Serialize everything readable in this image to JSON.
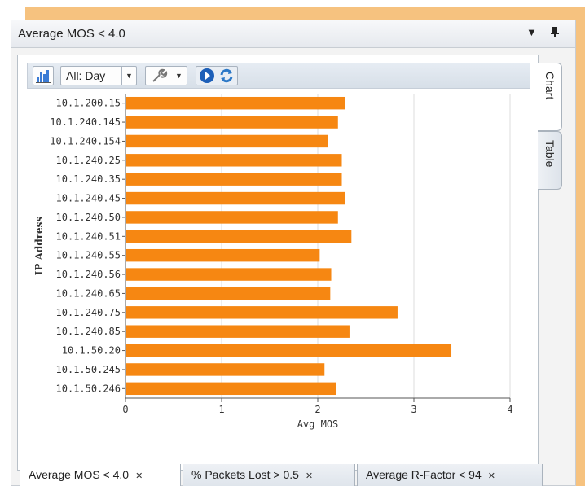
{
  "window": {
    "title": "Average MOS < 4.0"
  },
  "toolbar": {
    "range_label": "All: Day"
  },
  "side_tabs": [
    "Chart",
    "Table"
  ],
  "bottom_tabs": [
    {
      "label": "Average MOS < 4.0",
      "active": true
    },
    {
      "label": "% Packets Lost > 0.5",
      "active": false
    },
    {
      "label": "Average R-Factor < 94",
      "active": false
    }
  ],
  "colors": {
    "bar": "#f68712",
    "accent_frame": "#f6c27f"
  },
  "chart_data": {
    "type": "bar",
    "orientation": "horizontal",
    "xlabel": "Avg MOS",
    "ylabel": "IP Address",
    "xlim": [
      0,
      4
    ],
    "xticks": [
      "0",
      "1",
      "2",
      "3",
      "4"
    ],
    "grid": true,
    "categories": [
      "10.1.200.15",
      "10.1.240.145",
      "10.1.240.154",
      "10.1.240.25",
      "10.1.240.35",
      "10.1.240.45",
      "10.1.240.50",
      "10.1.240.51",
      "10.1.240.55",
      "10.1.240.56",
      "10.1.240.65",
      "10.1.240.75",
      "10.1.240.85",
      "10.1.50.20",
      "10.1.50.245",
      "10.1.50.246"
    ],
    "values": [
      2.28,
      2.21,
      2.11,
      2.25,
      2.25,
      2.28,
      2.21,
      2.35,
      2.02,
      2.14,
      2.13,
      2.83,
      2.33,
      3.39,
      2.07,
      2.19
    ]
  }
}
